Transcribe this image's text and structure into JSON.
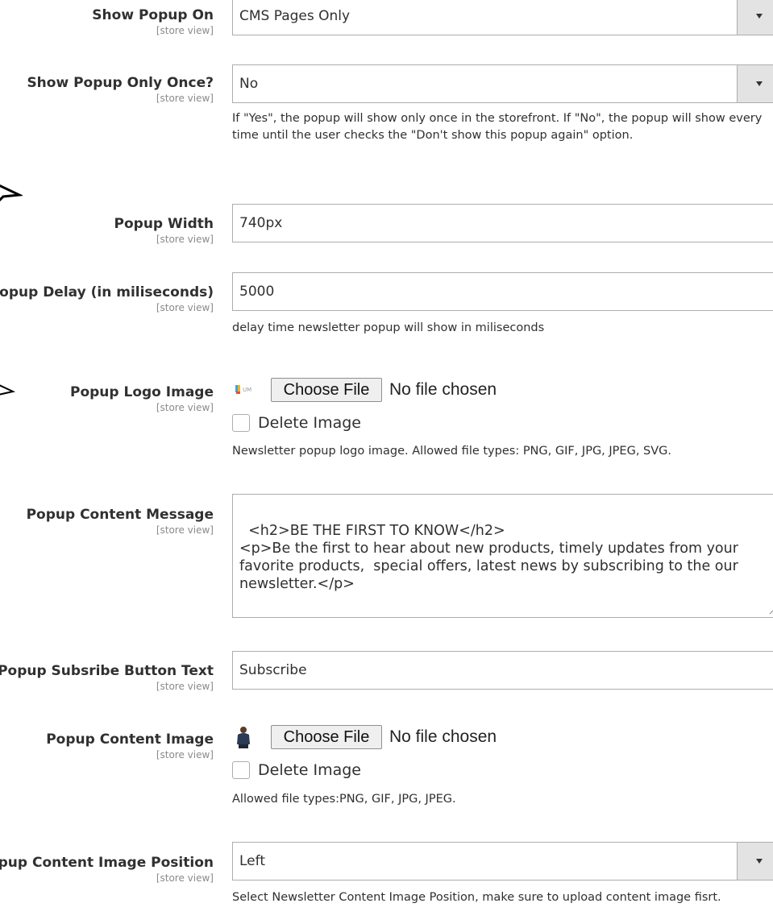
{
  "fields": {
    "show_popup_on": {
      "label": "Show Popup On",
      "scope": "[store view]",
      "value": "CMS Pages Only"
    },
    "show_popup_only_once": {
      "label": "Show Popup Only Once?",
      "scope": "[store view]",
      "value": "No",
      "note": "If \"Yes\", the popup will show only once in the storefront. If \"No\", the popup will show every time until the user checks the \"Don't show this popup again\" option."
    },
    "popup_width": {
      "label": "Popup Width",
      "scope": "[store view]",
      "value": "740px"
    },
    "popup_delay": {
      "label": "Popup Delay (in miliseconds)",
      "scope": "[store view]",
      "value": "5000",
      "note": "delay time newsletter popup will show in miliseconds"
    },
    "popup_logo_image": {
      "label": "Popup Logo Image",
      "scope": "[store view]",
      "choose_file": "Choose File",
      "file_status": "No file chosen",
      "delete_label": "Delete Image",
      "note": "Newsletter popup logo image. Allowed file types: PNG, GIF, JPG, JPEG, SVG."
    },
    "popup_content_message": {
      "label": "Popup Content Message",
      "scope": "[store view]",
      "value": "<h2>BE THE FIRST TO KNOW</h2>\n<p>Be the first to hear about new products, timely updates from your favorite products,  special offers, latest news by subscribing to the our newsletter.</p>"
    },
    "popup_subscribe_button_text": {
      "label": "Popup Subsribe Button Text",
      "scope": "[store view]",
      "value": "Subscribe"
    },
    "popup_content_image": {
      "label": "Popup Content Image",
      "scope": "[store view]",
      "choose_file": "Choose File",
      "file_status": "No file chosen",
      "delete_label": "Delete Image",
      "note": "Allowed file types:PNG, GIF, JPG, JPEG."
    },
    "popup_content_image_position": {
      "label": "Popup Content Image Position",
      "scope": "[store view]",
      "value": "Left",
      "note": "Select Newsletter Content Image Position, make sure to upload content image fisrt."
    }
  },
  "icons": {
    "select_arrow": "chevron-down-icon",
    "cursor": "mouse-cursor-icon",
    "logo_thumb": "logo-thumbnail-icon",
    "content_thumb": "content-image-thumbnail-icon",
    "resize": "resize-grip-icon"
  }
}
